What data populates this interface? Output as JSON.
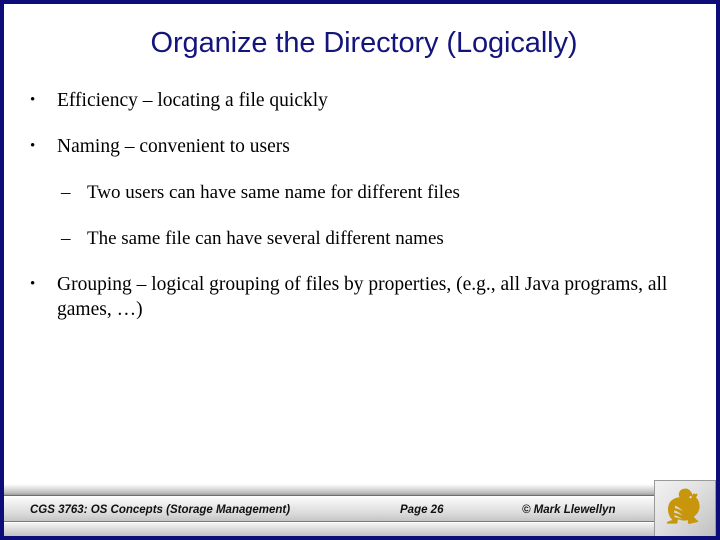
{
  "slide": {
    "title": "Organize the Directory (Logically)",
    "title_color": "#14147d",
    "border_color": "#0d0d7a",
    "background_color": "#ffffff",
    "bullets": [
      {
        "level": 1,
        "marker": "•",
        "text": "Efficiency – locating a file quickly"
      },
      {
        "level": 1,
        "marker": "•",
        "text": "Naming – convenient to users"
      },
      {
        "level": 2,
        "marker": "–",
        "text": "Two users can have same name for different files"
      },
      {
        "level": 2,
        "marker": "–",
        "text": "The same file can have several different names"
      },
      {
        "level": 1,
        "marker": "•",
        "text": "Grouping – logical grouping of files by properties, (e.g., all Java programs, all games, …)"
      }
    ]
  },
  "footer": {
    "course": "CGS 3763: OS Concepts  (Storage Management)",
    "page": "Page 26",
    "copyright": "© Mark Llewellyn",
    "logo_name": "ucf-pegasus-logo",
    "logo_color": "#c8960c"
  }
}
